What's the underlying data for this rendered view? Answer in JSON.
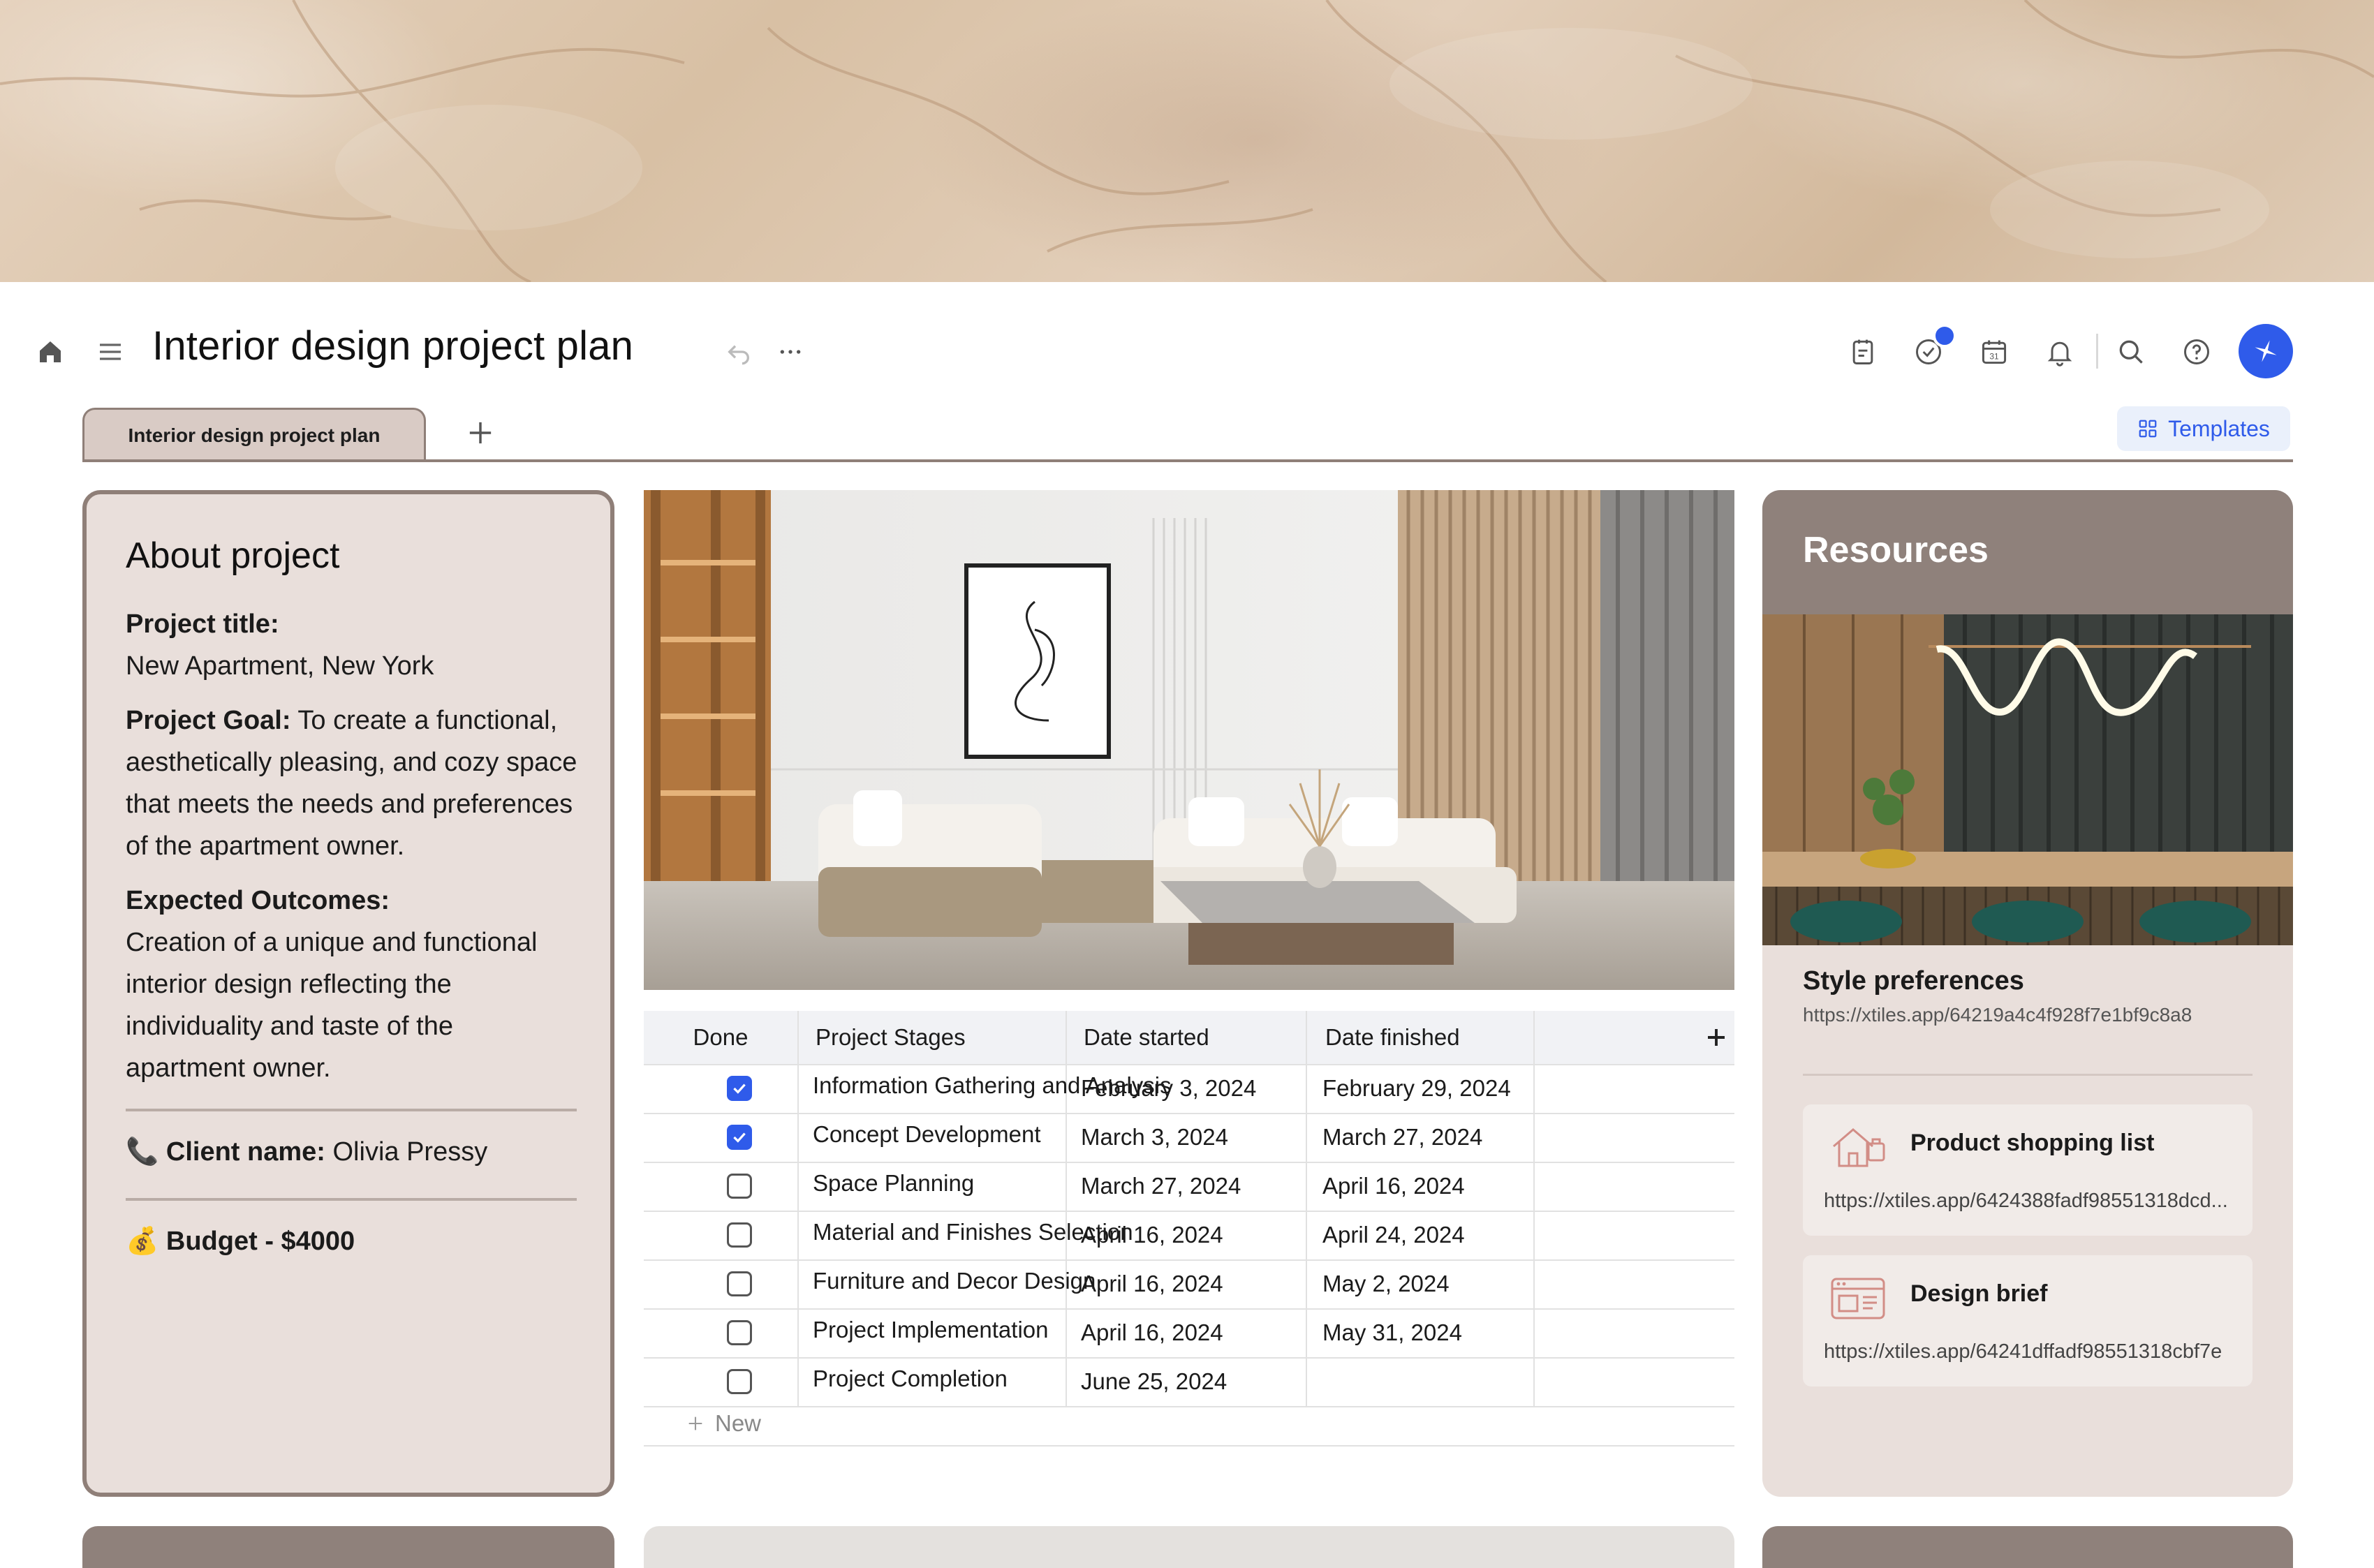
{
  "header": {
    "title": "Interior design project plan"
  },
  "tabs": [
    {
      "label": "Interior design project plan",
      "active": true
    }
  ],
  "templates_label": "Templates",
  "about": {
    "heading": "About project",
    "project_title_label": "Project title:",
    "project_title_value": "New Apartment, New York",
    "goal_label": "Project Goal:",
    "goal_value": "To create a functional, aesthetically pleasing, and cozy space that meets the needs and preferences of the apartment owner.",
    "outcomes_label": "Expected Outcomes:",
    "outcomes_value": "Creation of a unique and functional interior design reflecting the individuality and taste of the apartment owner.",
    "client_label": "Client name:",
    "client_value": "Olivia Pressy",
    "budget_label": "Budget - $4000"
  },
  "table": {
    "columns": [
      "Done",
      "Project Stages",
      "Date started",
      "Date finished"
    ],
    "rows": [
      {
        "done": true,
        "stage": "Information Gathering and Analysis",
        "start": "February 3, 2024",
        "end": "February 29, 2024"
      },
      {
        "done": true,
        "stage": "Concept Development",
        "start": "March 3, 2024",
        "end": "March 27, 2024"
      },
      {
        "done": false,
        "stage": "Space Planning",
        "start": "March 27, 2024",
        "end": "April 16, 2024"
      },
      {
        "done": false,
        "stage": "Material and Finishes Selection",
        "start": "April 16, 2024",
        "end": "April 24, 2024"
      },
      {
        "done": false,
        "stage": "Furniture and Decor Design",
        "start": "April 16, 2024",
        "end": "May 2, 2024"
      },
      {
        "done": false,
        "stage": "Project Implementation",
        "start": "April 16, 2024",
        "end": "May 31, 2024"
      },
      {
        "done": false,
        "stage": "Project Completion",
        "start": "June 25, 2024",
        "end": ""
      }
    ],
    "new_label": "New"
  },
  "resources": {
    "heading": "Resources",
    "style_label": "Style preferences",
    "style_url": "https://xtiles.app/64219a4c4f928f7e1bf9c8a8",
    "cards": [
      {
        "title": "Product shopping list",
        "url": "https://xtiles.app/6424388fadf98551318dcd...",
        "icon": "house-sketch-icon"
      },
      {
        "title": "Design brief",
        "url": "https://xtiles.app/64241dffadf98551318cbf7e",
        "icon": "browser-sketch-icon"
      }
    ]
  },
  "colors": {
    "accent": "#2f5bea",
    "card_border": "#8f7f78",
    "card_bg": "#e9dfdb",
    "resources_header": "#8f817b"
  }
}
